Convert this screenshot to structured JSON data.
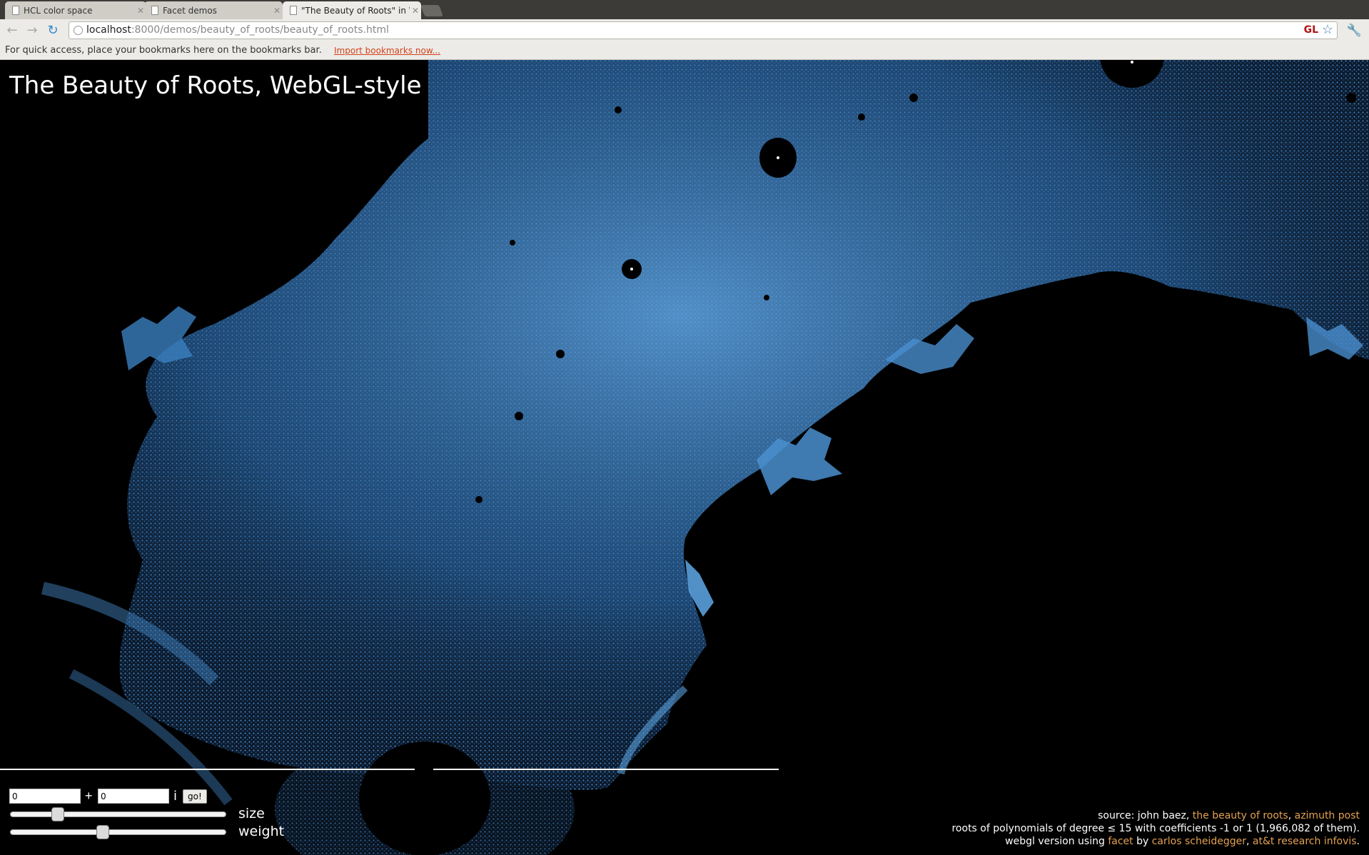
{
  "tabs": [
    {
      "title": "HCL color space"
    },
    {
      "title": "Facet demos"
    },
    {
      "title": "\"The Beauty of Roots\" in W"
    }
  ],
  "address": {
    "host": "localhost",
    "rest": ":8000/demos/beauty_of_roots/beauty_of_roots.html",
    "badge": "GL"
  },
  "bookmarks_bar": {
    "message": "For quick access, place your bookmarks here on the bookmarks bar.",
    "import_link": "Import bookmarks now..."
  },
  "page": {
    "title": "The Beauty of Roots, WebGL-style",
    "controls": {
      "real_value": "0",
      "plus": "+",
      "imag_value": "0",
      "imag_suffix": "i",
      "go_label": "go!",
      "size_label": "size",
      "weight_label": "weight",
      "size_fraction": 0.2,
      "weight_fraction": 0.42
    },
    "credits": {
      "l1_prefix": "source: john baez, ",
      "l1_link1": "the beauty of roots",
      "l1_sep": ", ",
      "l1_link2": "azimuth post",
      "l2": "roots of polynomials of degree ≤ 15 with coefficients -1 or 1 (1,966,082 of them).",
      "l3_prefix": "webgl version using ",
      "l3_link1": "facet",
      "l3_by": " by ",
      "l3_link2": "carlos scheidegger",
      "l3_sep": ", ",
      "l3_link3": "at&t research infovis",
      "l3_end": "."
    }
  },
  "colors": {
    "roots_blue": "#3b82c4",
    "link_orange": "#e3a152"
  }
}
